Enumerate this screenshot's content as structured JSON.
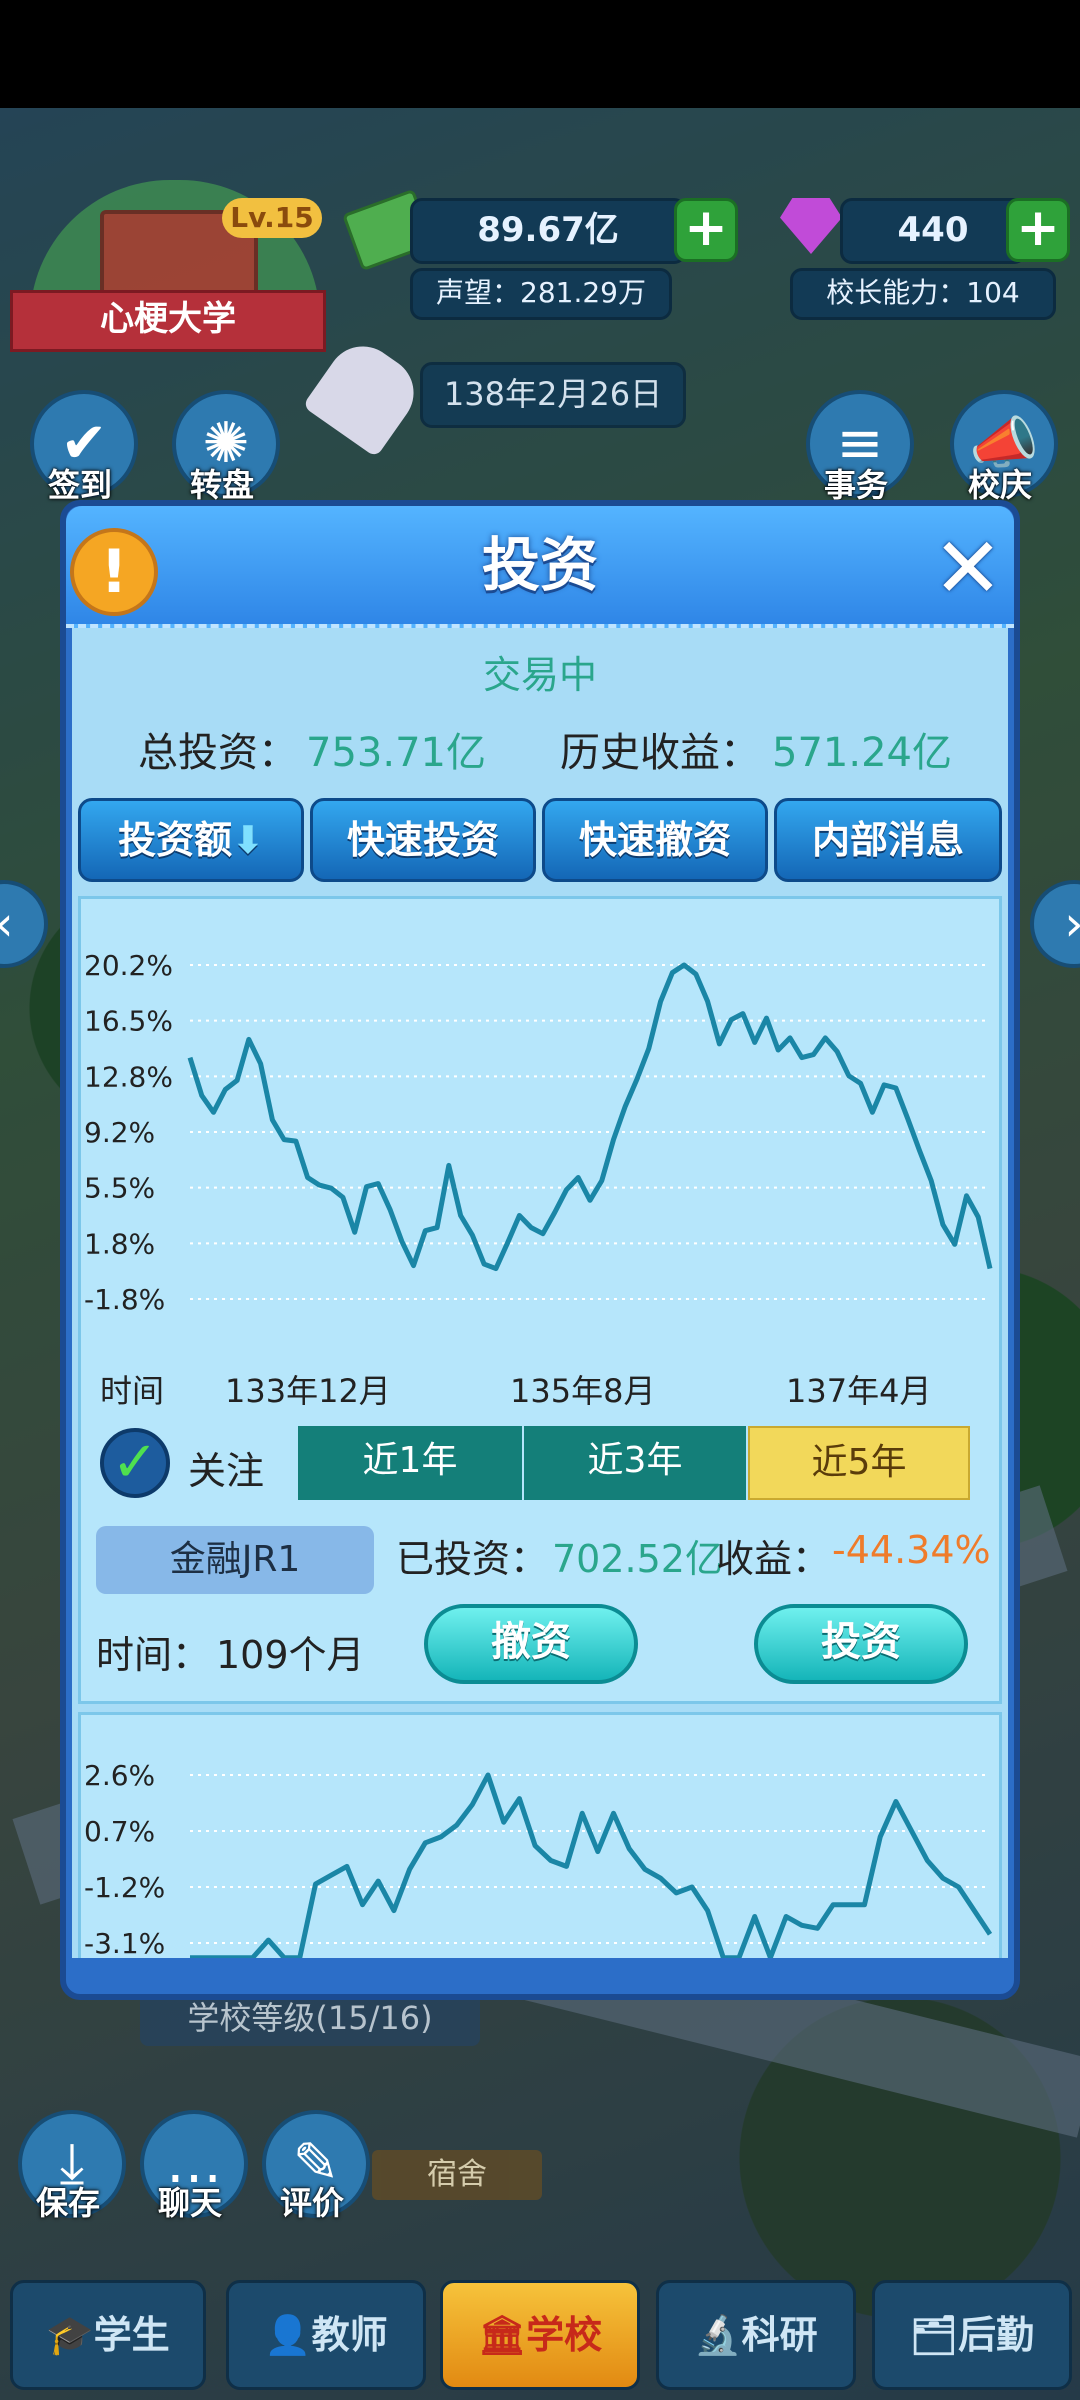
{
  "status_bar": {},
  "hud": {
    "school_name": "心梗大学",
    "level": "Lv.15",
    "money": "89.67亿",
    "gems": "440",
    "reputation": "声望：281.29万",
    "principal_ability": "校长能力：104",
    "date": "138年2月26日"
  },
  "side_buttons": {
    "checkin": "签到",
    "wheel": "转盘",
    "affairs": "事务",
    "celebration": "校庆"
  },
  "dialog": {
    "title": "投资",
    "trading_status": "交易中",
    "total_invest_label": "总投资：",
    "total_invest_value": "753.71亿",
    "history_profit_label": "历史收益：",
    "history_profit_value": "571.24亿",
    "toolbar": {
      "invest_amount": "投资额",
      "quick_invest": "快速投资",
      "quick_withdraw": "快速撤资",
      "inside_news": "内部消息"
    },
    "item": {
      "follow_label": "关注",
      "periods": [
        "近1年",
        "近3年",
        "近5年"
      ],
      "selected_period": "近5年",
      "name": "金融JR1",
      "invested_label": "已投资：",
      "invested_value": "702.52亿",
      "profit_label": "收益：",
      "profit_value": "-44.34%",
      "time_label": "时间：",
      "time_value": "109个月",
      "withdraw": "撤资",
      "invest": "投资"
    }
  },
  "bottom": {
    "school_level": "学校等级(15/16)",
    "save": "保存",
    "chat": "聊天",
    "review": "评价",
    "dorm": "宿舍",
    "tabs": [
      "学生",
      "教师",
      "学校",
      "科研",
      "后勤"
    ],
    "active_tab": "学校"
  },
  "colors": {
    "accent_green": "#2aa68c",
    "loss_orange": "#ef7b2a",
    "line": "#1a86a6",
    "selected_period": "#f2d85a"
  },
  "chart_data": [
    {
      "type": "line",
      "title": "",
      "xlabel": "时间",
      "ylabel": "",
      "y_ticks": [
        "20.2%",
        "16.5%",
        "12.8%",
        "9.2%",
        "5.5%",
        "1.8%",
        "-1.8%"
      ],
      "x_ticks": [
        "133年12月",
        "135年8月",
        "137年4月"
      ],
      "ylim": [
        -1.8,
        20.2
      ],
      "grid": true,
      "series": [
        {
          "values": [
            14.1,
            11.6,
            10.5,
            12.0,
            12.6,
            15.3,
            13.7,
            10.0,
            8.7,
            8.6,
            6.2,
            5.7,
            5.5,
            4.9,
            2.6,
            5.6,
            5.8,
            4.1,
            2.0,
            0.4,
            2.7,
            2.9,
            7.0,
            3.7,
            2.4,
            0.5,
            0.2,
            1.9,
            3.7,
            2.9,
            2.5,
            3.9,
            5.4,
            6.2,
            4.7,
            6.0,
            8.7,
            10.9,
            12.7,
            14.7,
            17.8,
            19.7,
            20.2,
            19.6,
            17.8,
            15.0,
            16.6,
            17.0,
            15.1,
            16.7,
            14.6,
            15.4,
            14.1,
            14.3,
            15.4,
            14.5,
            12.9,
            12.4,
            10.5,
            12.3,
            12.1,
            10.1,
            8.0,
            6.0,
            3.1,
            1.8,
            5.0,
            3.6,
            0.2
          ]
        }
      ]
    },
    {
      "type": "line",
      "title": "",
      "xlabel": "",
      "ylabel": "",
      "y_ticks": [
        "2.6%",
        "0.7%",
        "-1.2%",
        "-3.1%"
      ],
      "ylim": [
        -3.1,
        2.6
      ],
      "grid": true,
      "series": [
        {
          "values": [
            -3.6,
            -3.6,
            -3.6,
            -3.6,
            -3.6,
            -3.0,
            -3.6,
            -3.6,
            -1.1,
            -0.8,
            -0.5,
            -1.8,
            -1.0,
            -2.0,
            -0.6,
            0.3,
            0.5,
            0.9,
            1.6,
            2.6,
            1.0,
            1.8,
            0.2,
            -0.3,
            -0.5,
            1.3,
            0.0,
            1.3,
            0.1,
            -0.6,
            -0.9,
            -1.4,
            -1.2,
            -2.0,
            -3.6,
            -3.6,
            -2.2,
            -3.6,
            -2.2,
            -2.5,
            -2.6,
            -1.8,
            -1.8,
            -1.8,
            0.5,
            1.7,
            0.7,
            -0.3,
            -0.9,
            -1.2,
            -2.0,
            -2.8
          ]
        }
      ]
    }
  ]
}
